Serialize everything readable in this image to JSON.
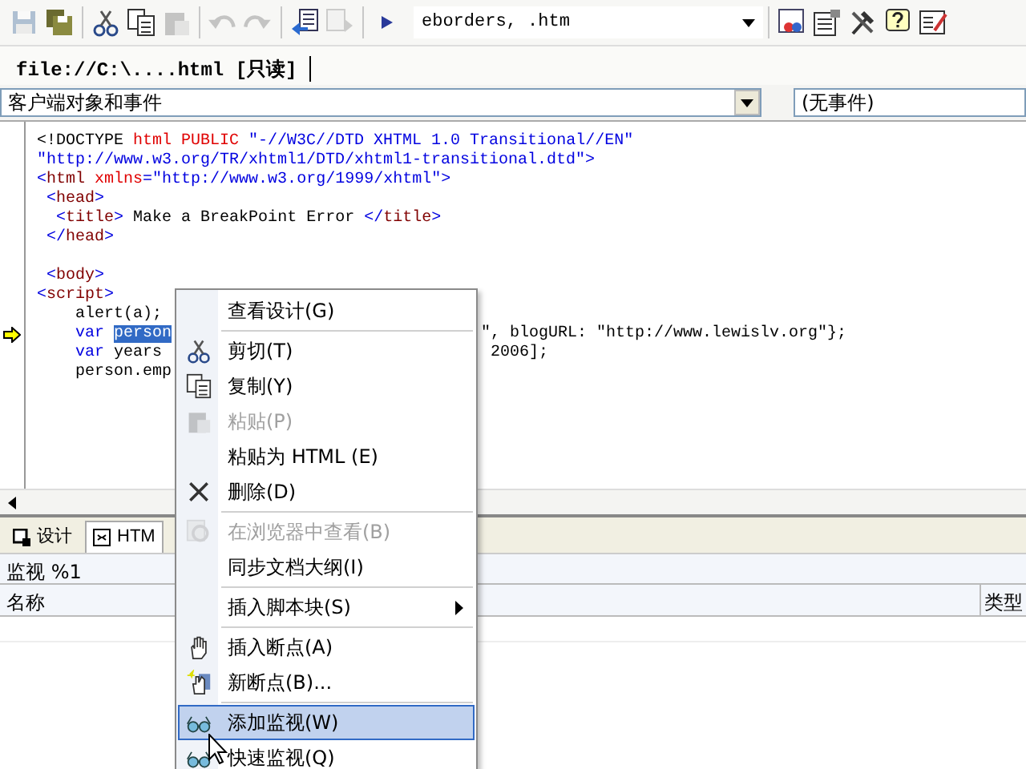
{
  "toolbar": {
    "items": [
      {
        "kind": "save",
        "disabled": true
      },
      {
        "kind": "save-all",
        "disabled": false
      },
      {
        "kind": "separator"
      },
      {
        "kind": "cut",
        "disabled": false
      },
      {
        "kind": "copy",
        "disabled": false
      },
      {
        "kind": "paste",
        "disabled": true
      },
      {
        "kind": "separator"
      },
      {
        "kind": "undo",
        "disabled": true
      },
      {
        "kind": "redo",
        "disabled": true
      },
      {
        "kind": "separator"
      },
      {
        "kind": "indent",
        "disabled": false
      },
      {
        "kind": "outdent",
        "disabled": true
      },
      {
        "kind": "separator"
      },
      {
        "kind": "run",
        "disabled": false
      }
    ],
    "combo": "eborders, .htm",
    "right_items": [
      {
        "kind": "palette",
        "disabled": false
      },
      {
        "kind": "properties",
        "disabled": false
      },
      {
        "kind": "tools",
        "disabled": false
      },
      {
        "kind": "help",
        "disabled": false
      },
      {
        "kind": "edit",
        "disabled": false
      }
    ]
  },
  "document_tab": {
    "title": "file://C:\\....html [只读]"
  },
  "object_dropdown": {
    "value": "客户端对象和事件"
  },
  "event_dropdown": {
    "value": "(无事件)"
  },
  "code_lines": [
    {
      "current": false,
      "segments": [
        {
          "kind": "text",
          "text": "<!DOCTYPE "
        },
        {
          "kind": "attr",
          "text": "html PUBLIC "
        },
        {
          "kind": "str",
          "text": "\"-//W3C//DTD XHTML 1.0 Transitional//EN\""
        }
      ]
    },
    {
      "current": false,
      "segments": [
        {
          "kind": "str",
          "text": "\"http://www.w3.org/TR/xhtml1/DTD/xhtml1-transitional.dtd\">"
        }
      ]
    },
    {
      "current": false,
      "segments": [
        {
          "kind": "punct",
          "text": "<"
        },
        {
          "kind": "tag",
          "text": "html "
        },
        {
          "kind": "attr",
          "text": "xmlns"
        },
        {
          "kind": "punct",
          "text": "=\"http://www.w3.org/1999/xhtml\">"
        }
      ]
    },
    {
      "current": false,
      "segments": [
        {
          "kind": "punct",
          "text": " <"
        },
        {
          "kind": "tag",
          "text": "head"
        },
        {
          "kind": "punct",
          "text": ">"
        }
      ]
    },
    {
      "current": false,
      "segments": [
        {
          "kind": "punct",
          "text": "  <"
        },
        {
          "kind": "tag",
          "text": "title"
        },
        {
          "kind": "punct",
          "text": ">"
        },
        {
          "kind": "text",
          "text": " Make a BreakPoint Error "
        },
        {
          "kind": "punct",
          "text": "</"
        },
        {
          "kind": "tag",
          "text": "title"
        },
        {
          "kind": "punct",
          "text": ">"
        }
      ]
    },
    {
      "current": false,
      "segments": [
        {
          "kind": "punct",
          "text": " </"
        },
        {
          "kind": "tag",
          "text": "head"
        },
        {
          "kind": "punct",
          "text": ">"
        }
      ]
    },
    {
      "current": false
    },
    {
      "current": false,
      "segments": [
        {
          "kind": "punct",
          "text": " <"
        },
        {
          "kind": "tag",
          "text": "body"
        },
        {
          "kind": "punct",
          "text": ">"
        }
      ]
    },
    {
      "current": false,
      "segments": [
        {
          "kind": "punct",
          "text": "<"
        },
        {
          "kind": "tag",
          "text": "script"
        },
        {
          "kind": "punct",
          "text": ">"
        }
      ]
    },
    {
      "current": false,
      "segments": [
        {
          "kind": "text",
          "text": "    alert(a);"
        }
      ]
    },
    {
      "current": true,
      "segments": [
        {
          "kind": "kw",
          "text": "    var "
        },
        {
          "kind": "sel",
          "text": "person"
        }
      ],
      "tail": "\", blogURL: \"http://www.lewislv.org\"};"
    },
    {
      "current": false,
      "segments": [
        {
          "kind": "kw",
          "text": "    var "
        },
        {
          "kind": "text",
          "text": "years"
        }
      ],
      "tail": " 2006];"
    },
    {
      "current": false,
      "segments": [
        {
          "kind": "text",
          "text": "    person.emp"
        }
      ]
    }
  ],
  "view_tabs": [
    {
      "label": "设计",
      "kind": "design",
      "selected": false
    },
    {
      "label": "HTM",
      "kind": "html",
      "selected": true
    }
  ],
  "watch_panel": {
    "title": "监视 %1",
    "columns": [
      "名称",
      "类型"
    ]
  },
  "context_menu": [
    {
      "kind": "item",
      "label": "查看设计(G)",
      "disabled": false,
      "selected": false,
      "submenu": false
    },
    {
      "kind": "separator"
    },
    {
      "kind": "item",
      "label": "剪切(T)",
      "disabled": false,
      "selected": false,
      "submenu": false
    },
    {
      "kind": "item",
      "label": "复制(Y)",
      "disabled": false,
      "selected": false,
      "submenu": false
    },
    {
      "kind": "item",
      "label": "粘贴(P)",
      "disabled": true,
      "selected": false,
      "submenu": false
    },
    {
      "kind": "item",
      "label": "粘贴为 HTML (E)",
      "disabled": false,
      "selected": false,
      "submenu": false
    },
    {
      "kind": "item",
      "label": "删除(D)",
      "disabled": false,
      "selected": false,
      "submenu": false
    },
    {
      "kind": "separator"
    },
    {
      "kind": "item",
      "label": "在浏览器中查看(B)",
      "disabled": true,
      "selected": false,
      "submenu": false
    },
    {
      "kind": "item",
      "label": "同步文档大纲(I)",
      "disabled": false,
      "selected": false,
      "submenu": false
    },
    {
      "kind": "separator"
    },
    {
      "kind": "item",
      "label": "插入脚本块(S)",
      "disabled": false,
      "selected": false,
      "submenu": true
    },
    {
      "kind": "separator"
    },
    {
      "kind": "item",
      "label": "插入断点(A)",
      "disabled": false,
      "selected": false,
      "submenu": false
    },
    {
      "kind": "item",
      "label": "新断点(B)...",
      "disabled": false,
      "selected": false,
      "submenu": false
    },
    {
      "kind": "separator"
    },
    {
      "kind": "item",
      "label": "添加监视(W)",
      "disabled": false,
      "selected": true,
      "submenu": false
    },
    {
      "kind": "item",
      "label": "快速监视(Q)",
      "disabled": false,
      "selected": false,
      "submenu": false
    }
  ]
}
